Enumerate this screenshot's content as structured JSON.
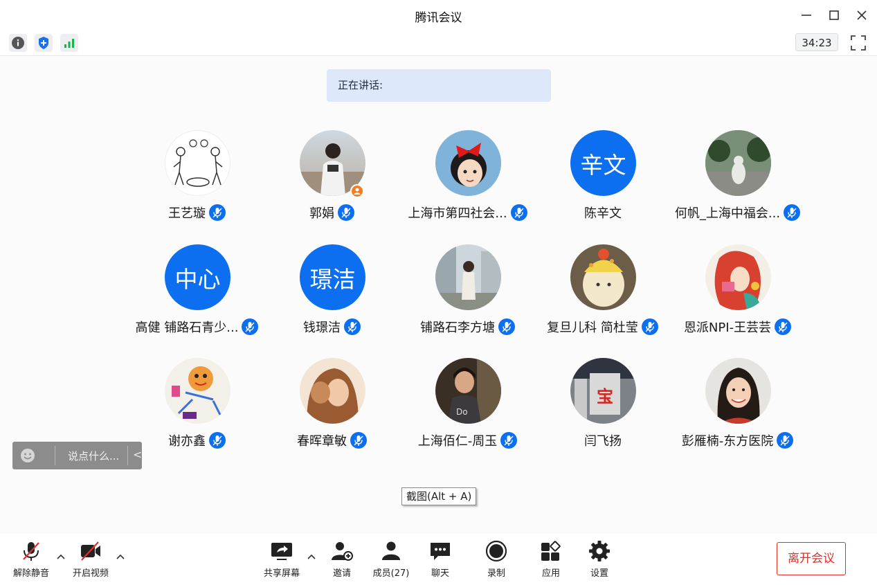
{
  "window": {
    "title": "腾讯会议"
  },
  "toolbar": {
    "timer": "34:23"
  },
  "speaking": {
    "label": "正在讲话:"
  },
  "participants": [
    {
      "name": "王艺璇",
      "avatar": "illustration"
    },
    {
      "name": "郭娟",
      "avatar": "photo",
      "host": true
    },
    {
      "name": "上海市第四社会...",
      "avatar": "anime"
    },
    {
      "name": "陈辛文",
      "avatar": "text",
      "avatar_text": "辛文"
    },
    {
      "name": "何帆_上海中福会...",
      "avatar": "photo"
    },
    {
      "name": "高健 铺路石青少...",
      "avatar": "text",
      "avatar_text": "中心"
    },
    {
      "name": "钱璟洁",
      "avatar": "text",
      "avatar_text": "璟洁"
    },
    {
      "name": "铺路石李方塘",
      "avatar": "photo"
    },
    {
      "name": "复旦儿科 简杜莹",
      "avatar": "photo"
    },
    {
      "name": "恩派NPI-王芸芸",
      "avatar": "illustration"
    },
    {
      "name": "谢亦鑫",
      "avatar": "illustration"
    },
    {
      "name": "春晖章敏",
      "avatar": "photo"
    },
    {
      "name": "上海佰仁-周玉",
      "avatar": "photo"
    },
    {
      "name": "闫飞扬",
      "avatar": "photo",
      "photo_text": "宝"
    },
    {
      "name": "彭雁楠-东方医院",
      "avatar": "photo"
    }
  ],
  "chat": {
    "placeholder": "说点什么...",
    "collapse_icon": "<"
  },
  "tooltip": "截图(Alt + A)",
  "bottom": {
    "unmute": "解除静音",
    "start_video": "开启视频",
    "share_screen": "共享屏幕",
    "invite": "邀请",
    "members": "成员(27)",
    "chat": "聊天",
    "record": "录制",
    "apps": "应用",
    "settings": "设置",
    "leave": "离开会议"
  },
  "colors": {
    "accent": "#0b6ff0",
    "leave": "#e0302a",
    "speaking_bg": "#dde9fb"
  }
}
